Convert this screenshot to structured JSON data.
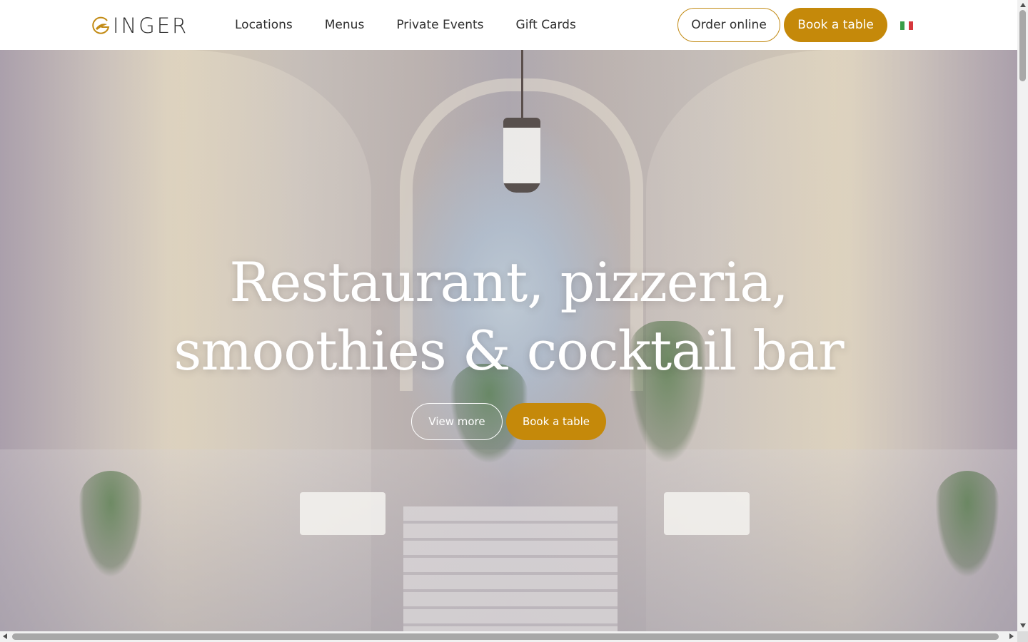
{
  "header": {
    "logo_text": "INGER",
    "logo_mark": "G",
    "nav": [
      {
        "label": "Locations"
      },
      {
        "label": "Menus"
      },
      {
        "label": "Private Events"
      },
      {
        "label": "Gift Cards"
      }
    ],
    "order_online_label": "Order online",
    "book_table_label": "Book a table",
    "language_flag": "italy-flag-icon"
  },
  "hero": {
    "title_line1": "Restaurant, pizzeria,",
    "title_line2": "smoothies & cocktail bar",
    "view_more_label": "View more",
    "book_table_label": "Book a table"
  },
  "colors": {
    "accent": "#c5890a",
    "accent_border": "#c28a13",
    "text_dark": "#2f2f2f",
    "flag_green": "#3a9d48",
    "flag_white": "#ffffff",
    "flag_red": "#d6373c"
  }
}
